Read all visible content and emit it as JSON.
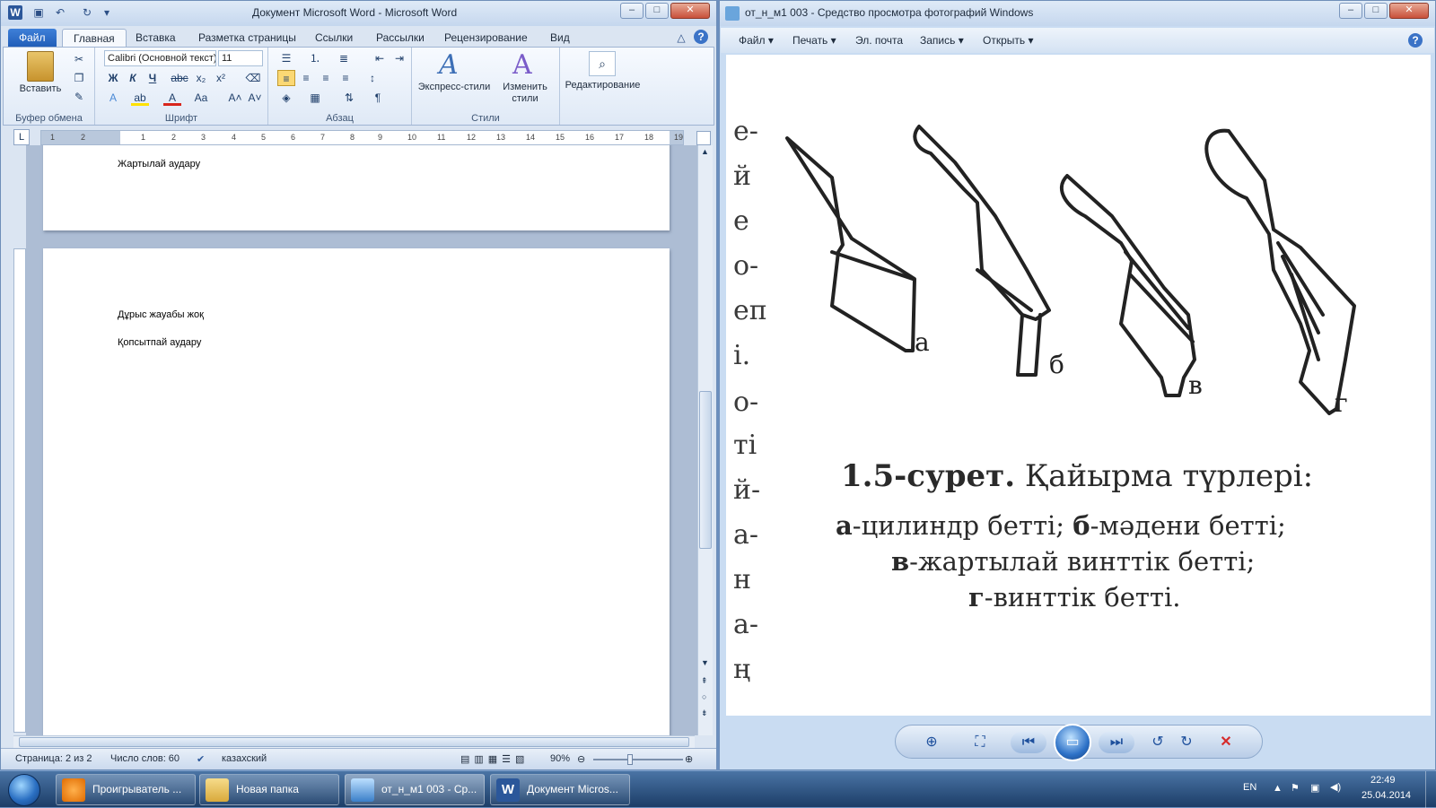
{
  "word": {
    "title": "Документ Microsoft Word  -  Microsoft Word",
    "window_controls": {
      "minimize": "–",
      "maximize": "□",
      "close": "✕"
    },
    "tabs": [
      "Файл",
      "Главная",
      "Вставка",
      "Разметка страницы",
      "Ссылки",
      "Рассылки",
      "Рецензирование",
      "Вид"
    ],
    "clipboard": {
      "paste_label": "Вставить",
      "group_label": "Буфер обмена"
    },
    "font": {
      "name": "Calibri (Основной текст)",
      "size": "11",
      "group_label": "Шрифт"
    },
    "paragraph": {
      "group_label": "Абзац"
    },
    "styles": {
      "express_label": "Экспресс-стили",
      "change_label_1": "Изменить",
      "change_label_2": "стили",
      "group_label": "Стили"
    },
    "editing": {
      "label": "Редактирование"
    },
    "ruler_numbers": [
      "1",
      "2",
      "1",
      "2",
      "3",
      "4",
      "5",
      "6",
      "7",
      "8",
      "9",
      "10",
      "11",
      "12",
      "13",
      "14",
      "15",
      "16",
      "17",
      "18",
      "19"
    ],
    "page1_text": "Жартылай аудару",
    "page2_line1": "Дұрыс жауабы жоқ",
    "page2_line2": "Қопсытпай аудару",
    "status": {
      "page": "Страница: 2 из 2",
      "words": "Число слов: 60",
      "language": "казахский",
      "zoom": "90%"
    }
  },
  "viewer": {
    "title": "от_н_м1 003 - Средство просмотра фотографий Windows",
    "menu": [
      "Файл",
      "Печать",
      "Эл. почта",
      "Запись",
      "Открыть"
    ],
    "image": {
      "letters": [
        "а",
        "б",
        "в",
        "г"
      ],
      "caption_title_bold": "1.5-сурет.",
      "caption_title_rest": "Қайырма  түрлері:",
      "line1_a": "а",
      "line1_a_rest": "-цилиндр  бетті;",
      "line1_b": "б",
      "line1_b_rest": "-мәдени  бетті;",
      "line2_b": "в",
      "line2_rest": "-жартылай  винттік  бетті;",
      "line3_b": "г",
      "line3_rest": "-винттік  бетті.",
      "side_chars": [
        "е-",
        "й",
        "е",
        "о-",
        "еп",
        "і.",
        "о-",
        "ті",
        "й-",
        "а-",
        "н",
        "а-",
        "ң"
      ]
    }
  },
  "taskbar": {
    "items": [
      "Проигрыватель ...",
      "Новая папка",
      "от_н_м1 003 - Ср...",
      "Документ Micros..."
    ],
    "lang": "EN",
    "time": "22:49",
    "date": "25.04.2014"
  },
  "colors": {
    "word_blue": "#2b579a",
    "viewer_bg": "#c9dcf2",
    "taskbar": "#1c3d67"
  }
}
